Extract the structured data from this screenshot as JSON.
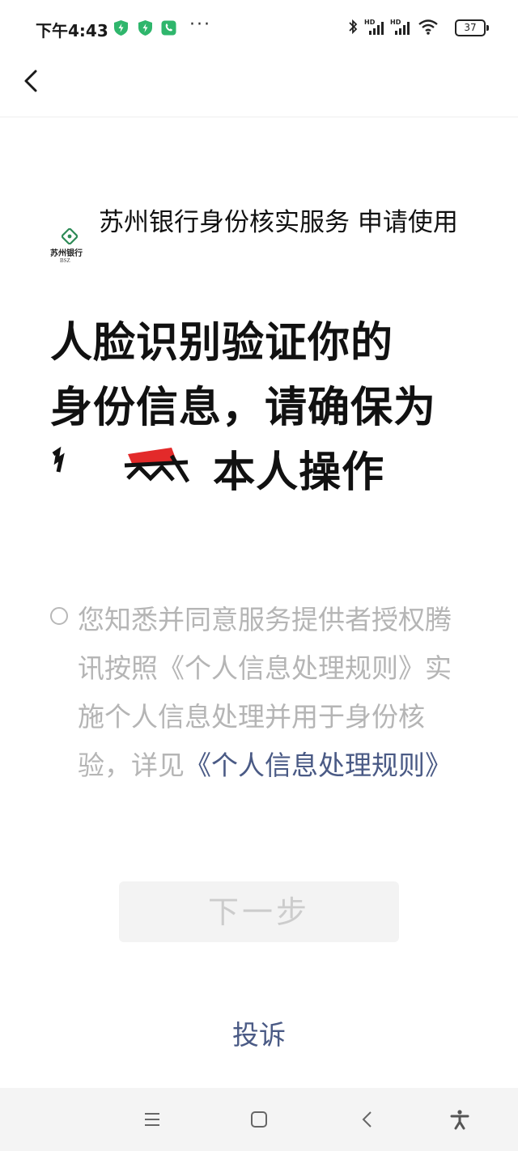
{
  "status_bar": {
    "time": "下午4:43",
    "more": "···",
    "battery": "37",
    "icons": [
      "shield-app-icon",
      "shield-app-icon",
      "phone-app-icon",
      "bluetooth-icon",
      "hd-signal-icon",
      "hd-signal-icon",
      "wifi-icon",
      "battery-icon"
    ]
  },
  "header": {
    "back_icon": "chevron-left-icon"
  },
  "app_info": {
    "logo_text": "苏州银行",
    "logo_sub": "BSZ",
    "title": "苏州银行身份核实服务 申请使用"
  },
  "heading": {
    "line1": "人脸识别验证你的",
    "line2": "身份信息，请确保为",
    "line3_suffix": "本人操作"
  },
  "consent": {
    "text_before": "您知悉并同意服务提供者授权腾讯按照《个人信息处理规则》实施个人信息处理并用于身份核验，详见",
    "link": "《个人信息处理规则》"
  },
  "next_button": {
    "label": "下一步"
  },
  "complaint": {
    "label": "投诉"
  },
  "colors": {
    "link": "#4a5a85",
    "disabled_text": "#cccccc",
    "app_green": "#2fb66c"
  }
}
